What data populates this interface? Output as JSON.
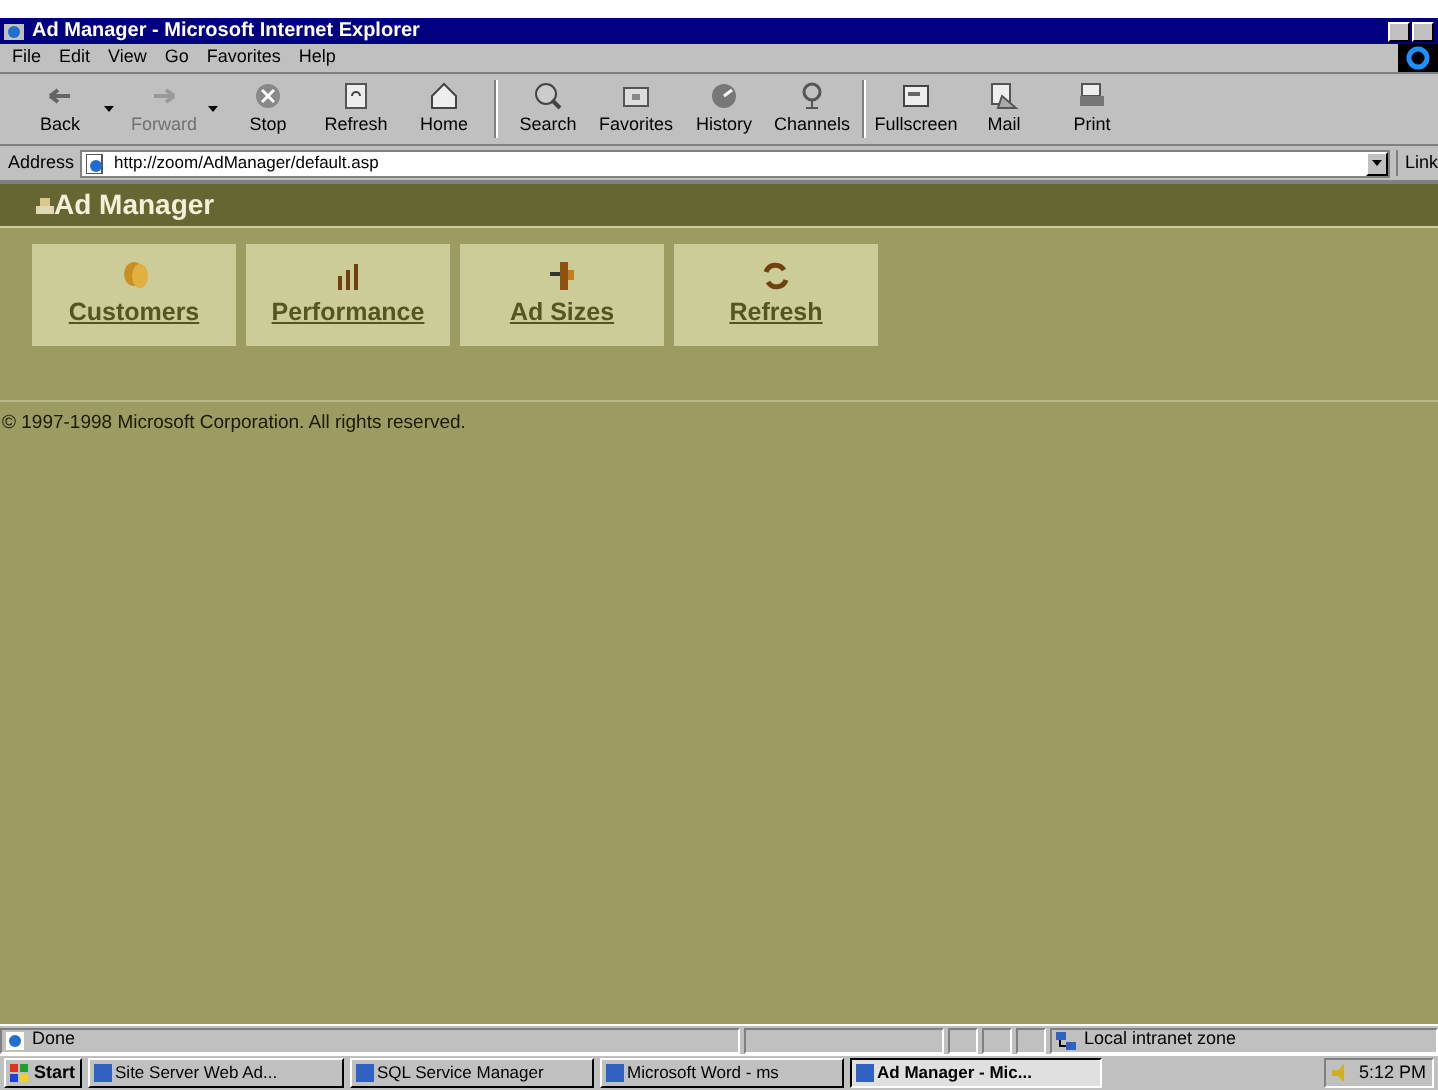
{
  "window": {
    "title": "Ad Manager - Microsoft Internet Explorer"
  },
  "menu": [
    "File",
    "Edit",
    "View",
    "Go",
    "Favorites",
    "Help"
  ],
  "toolbar": [
    {
      "label": "Back",
      "kind": "back",
      "disabled": false,
      "dropdown": true
    },
    {
      "label": "Forward",
      "kind": "forward",
      "disabled": true,
      "dropdown": true
    },
    {
      "label": "Stop",
      "kind": "stop",
      "disabled": false,
      "dropdown": false
    },
    {
      "label": "Refresh",
      "kind": "refresh",
      "disabled": false,
      "dropdown": false
    },
    {
      "label": "Home",
      "kind": "home",
      "disabled": false,
      "dropdown": false
    },
    {
      "label": "Search",
      "kind": "search",
      "disabled": false,
      "dropdown": false
    },
    {
      "label": "Favorites",
      "kind": "favorites",
      "disabled": false,
      "dropdown": false
    },
    {
      "label": "History",
      "kind": "history",
      "disabled": false,
      "dropdown": false
    },
    {
      "label": "Channels",
      "kind": "channels",
      "disabled": false,
      "dropdown": false
    },
    {
      "label": "Fullscreen",
      "kind": "fullscreen",
      "disabled": false,
      "dropdown": false
    },
    {
      "label": "Mail",
      "kind": "mail",
      "disabled": false,
      "dropdown": false
    },
    {
      "label": "Print",
      "kind": "print",
      "disabled": false,
      "dropdown": false
    }
  ],
  "address_bar": {
    "label": "Address",
    "value": "http://zoom/AdManager/default.asp",
    "links": "Link"
  },
  "page": {
    "title": "Ad Manager",
    "nav": [
      {
        "label": "Customers",
        "kind": "customers"
      },
      {
        "label": "Performance",
        "kind": "performance"
      },
      {
        "label": "Ad Sizes",
        "kind": "adsizes"
      },
      {
        "label": "Refresh",
        "kind": "refresh"
      }
    ],
    "footer": "© 1997-1998 Microsoft Corporation. All rights reserved."
  },
  "status_bar": {
    "text": "Done",
    "zone": "Local intranet zone"
  },
  "taskbar": {
    "start": "Start",
    "tasks": [
      {
        "label": "Site Server Web Ad...",
        "selected": false
      },
      {
        "label": "SQL Service Manager",
        "selected": false
      },
      {
        "label": "Microsoft Word - ms",
        "selected": false
      },
      {
        "label": "Ad Manager - Mic...",
        "selected": true
      }
    ],
    "clock": "5:12 PM"
  }
}
